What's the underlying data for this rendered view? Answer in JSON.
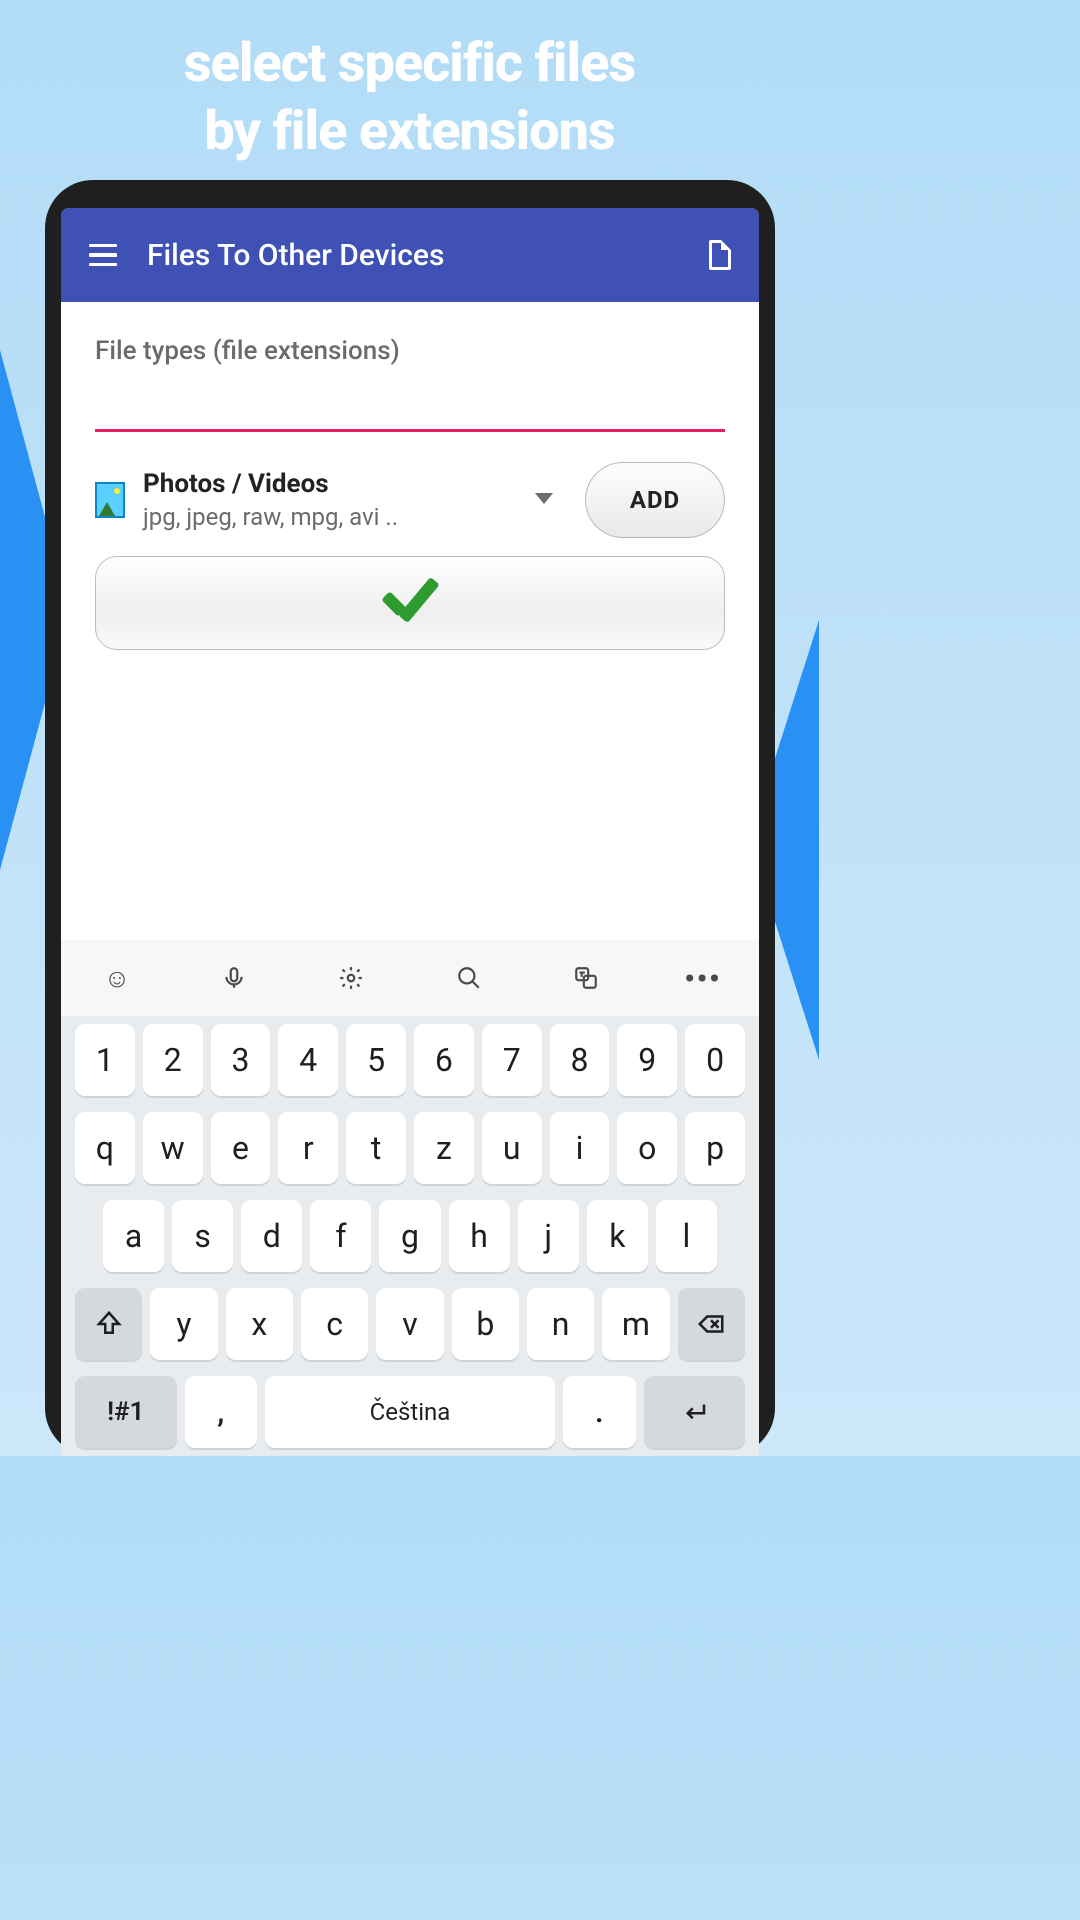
{
  "promo": {
    "line1": "select specific files",
    "line2": "by file extensions"
  },
  "appbar": {
    "title": "Files To Other Devices"
  },
  "content": {
    "label": "File types (file extensions)",
    "input_value": "",
    "category": {
      "name": "Photos / Videos",
      "exts": "jpg, jpeg, raw, mpg, avi .."
    },
    "add_label": "ADD"
  },
  "keyboard": {
    "row_num": [
      "1",
      "2",
      "3",
      "4",
      "5",
      "6",
      "7",
      "8",
      "9",
      "0"
    ],
    "row_a": [
      "q",
      "w",
      "e",
      "r",
      "t",
      "z",
      "u",
      "i",
      "o",
      "p"
    ],
    "row_b": [
      "a",
      "s",
      "d",
      "f",
      "g",
      "h",
      "j",
      "k",
      "l"
    ],
    "row_c": [
      "y",
      "x",
      "c",
      "v",
      "b",
      "n",
      "m"
    ],
    "fn_label": "!#1",
    "comma": ",",
    "space_label": "Čeština",
    "period": "."
  }
}
